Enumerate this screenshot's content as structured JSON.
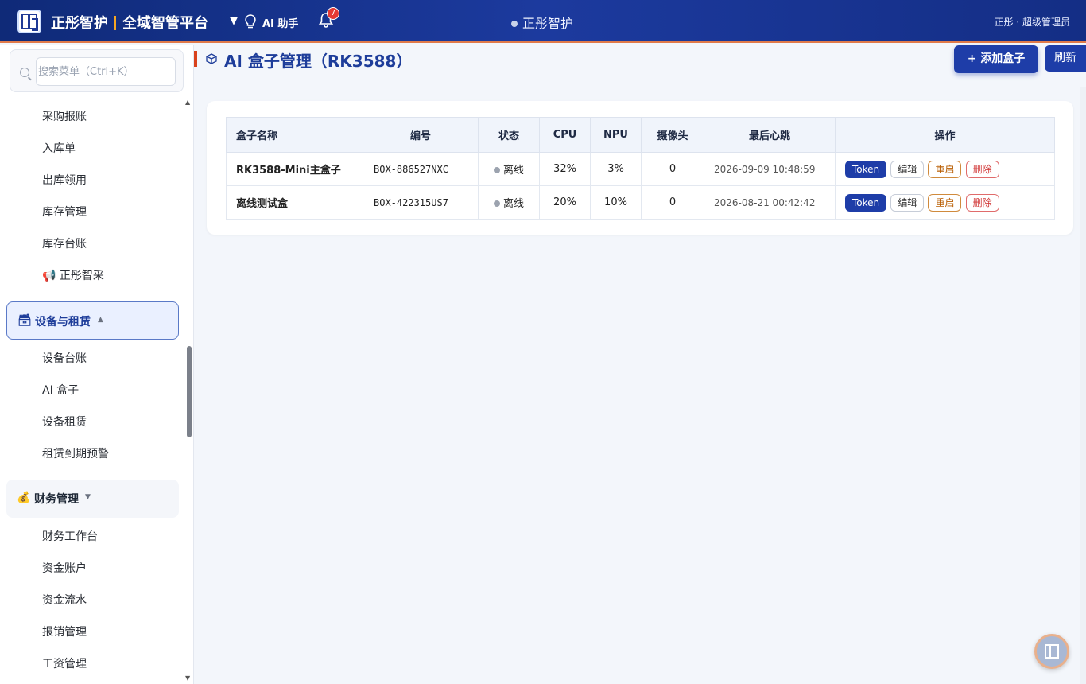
{
  "header": {
    "brand_left": "正彤智护",
    "brand_right": "全域智管平台",
    "dropdown_caret": "▼",
    "ai_assistant": "AI 助手",
    "notification_count": "7",
    "center_title": "正彤智护",
    "user": "正彤 · 超级管理员"
  },
  "sidebar": {
    "search_placeholder": "搜索菜单（Ctrl+K）",
    "items_top": [
      "采购报账",
      "入库单",
      "出库领用",
      "库存管理",
      "库存台账",
      "📢 正彤智采"
    ],
    "group_equipment": {
      "icon": "🗃",
      "label": "设备与租赁",
      "caret": "▲"
    },
    "items_equipment": [
      "设备台账",
      "AI 盒子",
      "设备租赁",
      "租赁到期预警"
    ],
    "group_finance": {
      "icon": "💰",
      "label": "财务管理",
      "caret": "▼"
    },
    "items_finance": [
      "财务工作台",
      "资金账户",
      "资金流水",
      "报销管理",
      "工资管理"
    ]
  },
  "page": {
    "title": "AI 盒子管理（RK3588）",
    "add_button": "+ 添加盒子",
    "refresh_button": "刷新"
  },
  "table": {
    "headers": [
      "盒子名称",
      "编号",
      "状态",
      "CPU",
      "NPU",
      "摄像头",
      "最后心跳",
      "操作"
    ],
    "rows": [
      {
        "name": "RK3588-Mini主盒子",
        "code": "BOX-886527NXC",
        "status": "离线",
        "cpu": "32%",
        "npu": "3%",
        "cameras": "0",
        "heartbeat": "2026-09-09 10:48:59"
      },
      {
        "name": "离线测试盒",
        "code": "BOX-422315US7",
        "status": "离线",
        "cpu": "20%",
        "npu": "10%",
        "cameras": "0",
        "heartbeat": "2026-08-21 00:42:42"
      }
    ],
    "ops": {
      "token": "Token",
      "edit": "编辑",
      "restart": "重启",
      "delete": "删除"
    }
  },
  "colors": {
    "primary": "#1e3da8",
    "header_start": "#0f2a78",
    "accent": "#d9421c",
    "status_offline": "#9ca3af"
  }
}
